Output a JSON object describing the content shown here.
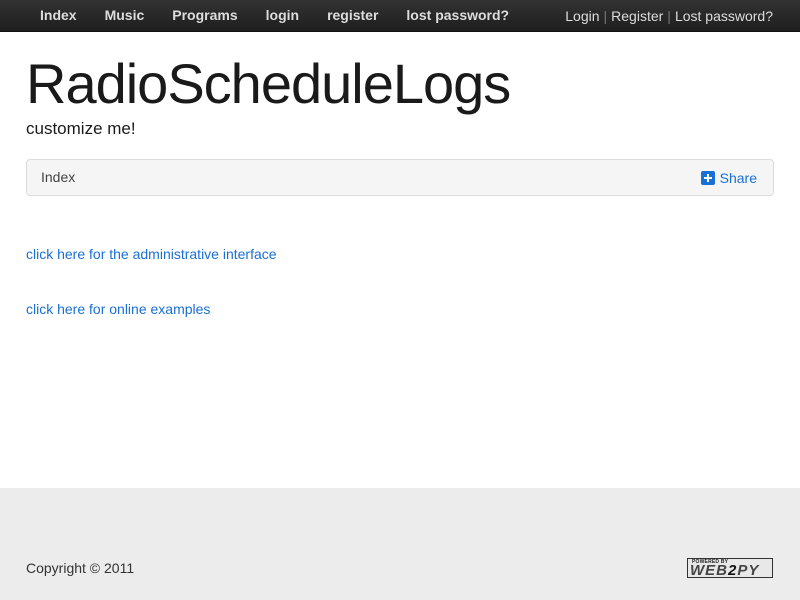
{
  "nav": {
    "left_items": [
      "Index",
      "Music",
      "Programs",
      "login",
      "register",
      "lost password?"
    ],
    "right_items": [
      "Login",
      "Register",
      "Lost password?"
    ],
    "separator": "|"
  },
  "header": {
    "title": "RadioScheduleLogs",
    "subtitle": "customize me!"
  },
  "breadcrumb": {
    "current": "Index",
    "share_label": "Share"
  },
  "links": {
    "admin": "click here for the administrative interface",
    "examples": "click here for online examples"
  },
  "footer": {
    "copyright": "Copyright © 2011",
    "badge_top": "POWERED BY",
    "badge_main_a": "WEB",
    "badge_main_b": "2",
    "badge_main_c": "PY"
  },
  "colors": {
    "navbar": "#222222",
    "link": "#1a6fd6",
    "footer_bg": "#ececec"
  }
}
